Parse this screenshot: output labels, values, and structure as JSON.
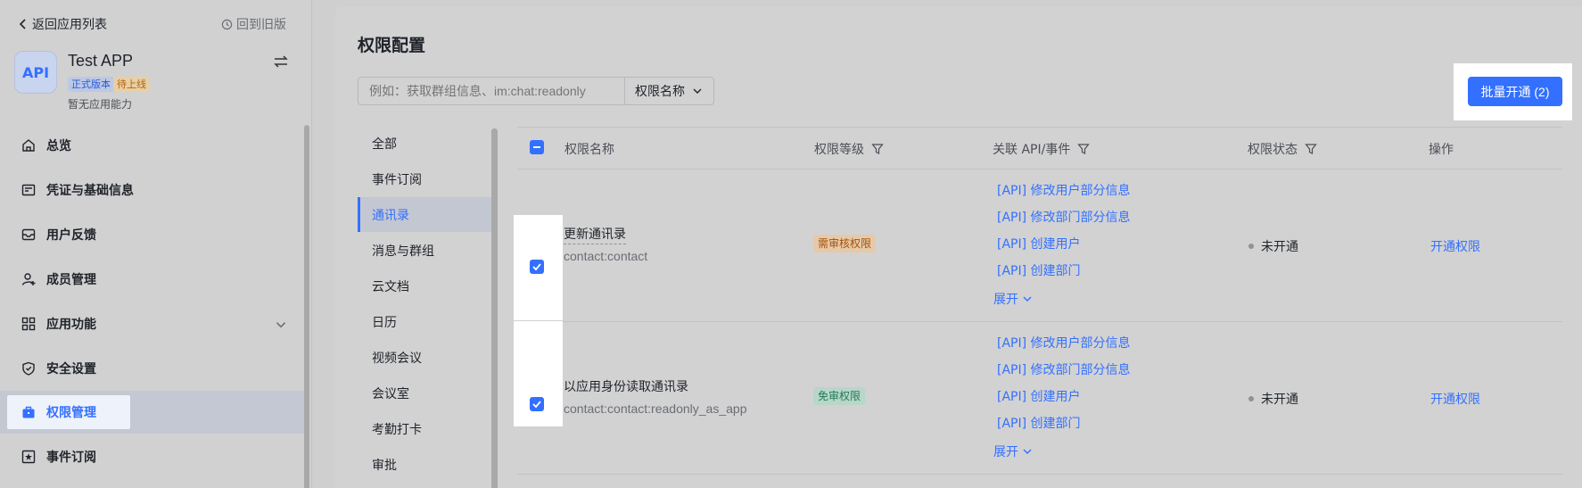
{
  "sidebar": {
    "back_label": "返回应用列表",
    "old_version_label": "回到旧版",
    "app": {
      "icon_text": "API",
      "name": "Test APP",
      "badge_live": "正式版本",
      "badge_pending": "待上线",
      "subtitle": "暂无应用能力"
    },
    "items": [
      {
        "label": "总览",
        "icon": "home-icon"
      },
      {
        "label": "凭证与基础信息",
        "icon": "id-card-icon"
      },
      {
        "label": "用户反馈",
        "icon": "inbox-icon"
      },
      {
        "label": "成员管理",
        "icon": "user-add-icon"
      },
      {
        "label": "应用功能",
        "icon": "grid-icon"
      },
      {
        "label": "安全设置",
        "icon": "shield-icon"
      },
      {
        "label": "权限管理",
        "icon": "briefcase-icon",
        "active": true
      },
      {
        "label": "事件订阅",
        "icon": "event-icon"
      }
    ]
  },
  "main": {
    "title": "权限配置",
    "search": {
      "placeholder": "例如：获取群组信息、im:chat:readonly",
      "filter_value": "权限名称"
    },
    "batch_button": "批量开通 (2)",
    "categories": [
      "全部",
      "事件订阅",
      "通讯录",
      "消息与群组",
      "云文档",
      "日历",
      "视频会议",
      "会议室",
      "考勤打卡",
      "审批"
    ],
    "active_category": "通讯录",
    "table": {
      "headers": {
        "name": "权限名称",
        "level": "权限等级",
        "api": "关联 API/事件",
        "status": "权限状态",
        "action": "操作"
      },
      "rows": [
        {
          "name": "更新通讯录",
          "code": "contact:contact",
          "level": "需审核权限",
          "apis": [
            "[API] 修改用户部分信息",
            "[API] 修改部门部分信息",
            "[API] 创建用户",
            "[API] 创建部门"
          ],
          "expand": "展开",
          "status": "未开通",
          "action": "开通权限"
        },
        {
          "name": "以应用身份读取通讯录",
          "code": "contact:contact:readonly_as_app",
          "level": "免审权限",
          "apis": [
            "[API] 修改用户部分信息",
            "[API] 修改部门部分信息",
            "[API] 创建用户",
            "[API] 创建部门"
          ],
          "expand": "展开",
          "status": "未开通",
          "action": "开通权限"
        }
      ]
    }
  },
  "colors": {
    "accent": "#3370ff",
    "review_badge": "#a3520a",
    "free_badge": "#1f7a57"
  }
}
